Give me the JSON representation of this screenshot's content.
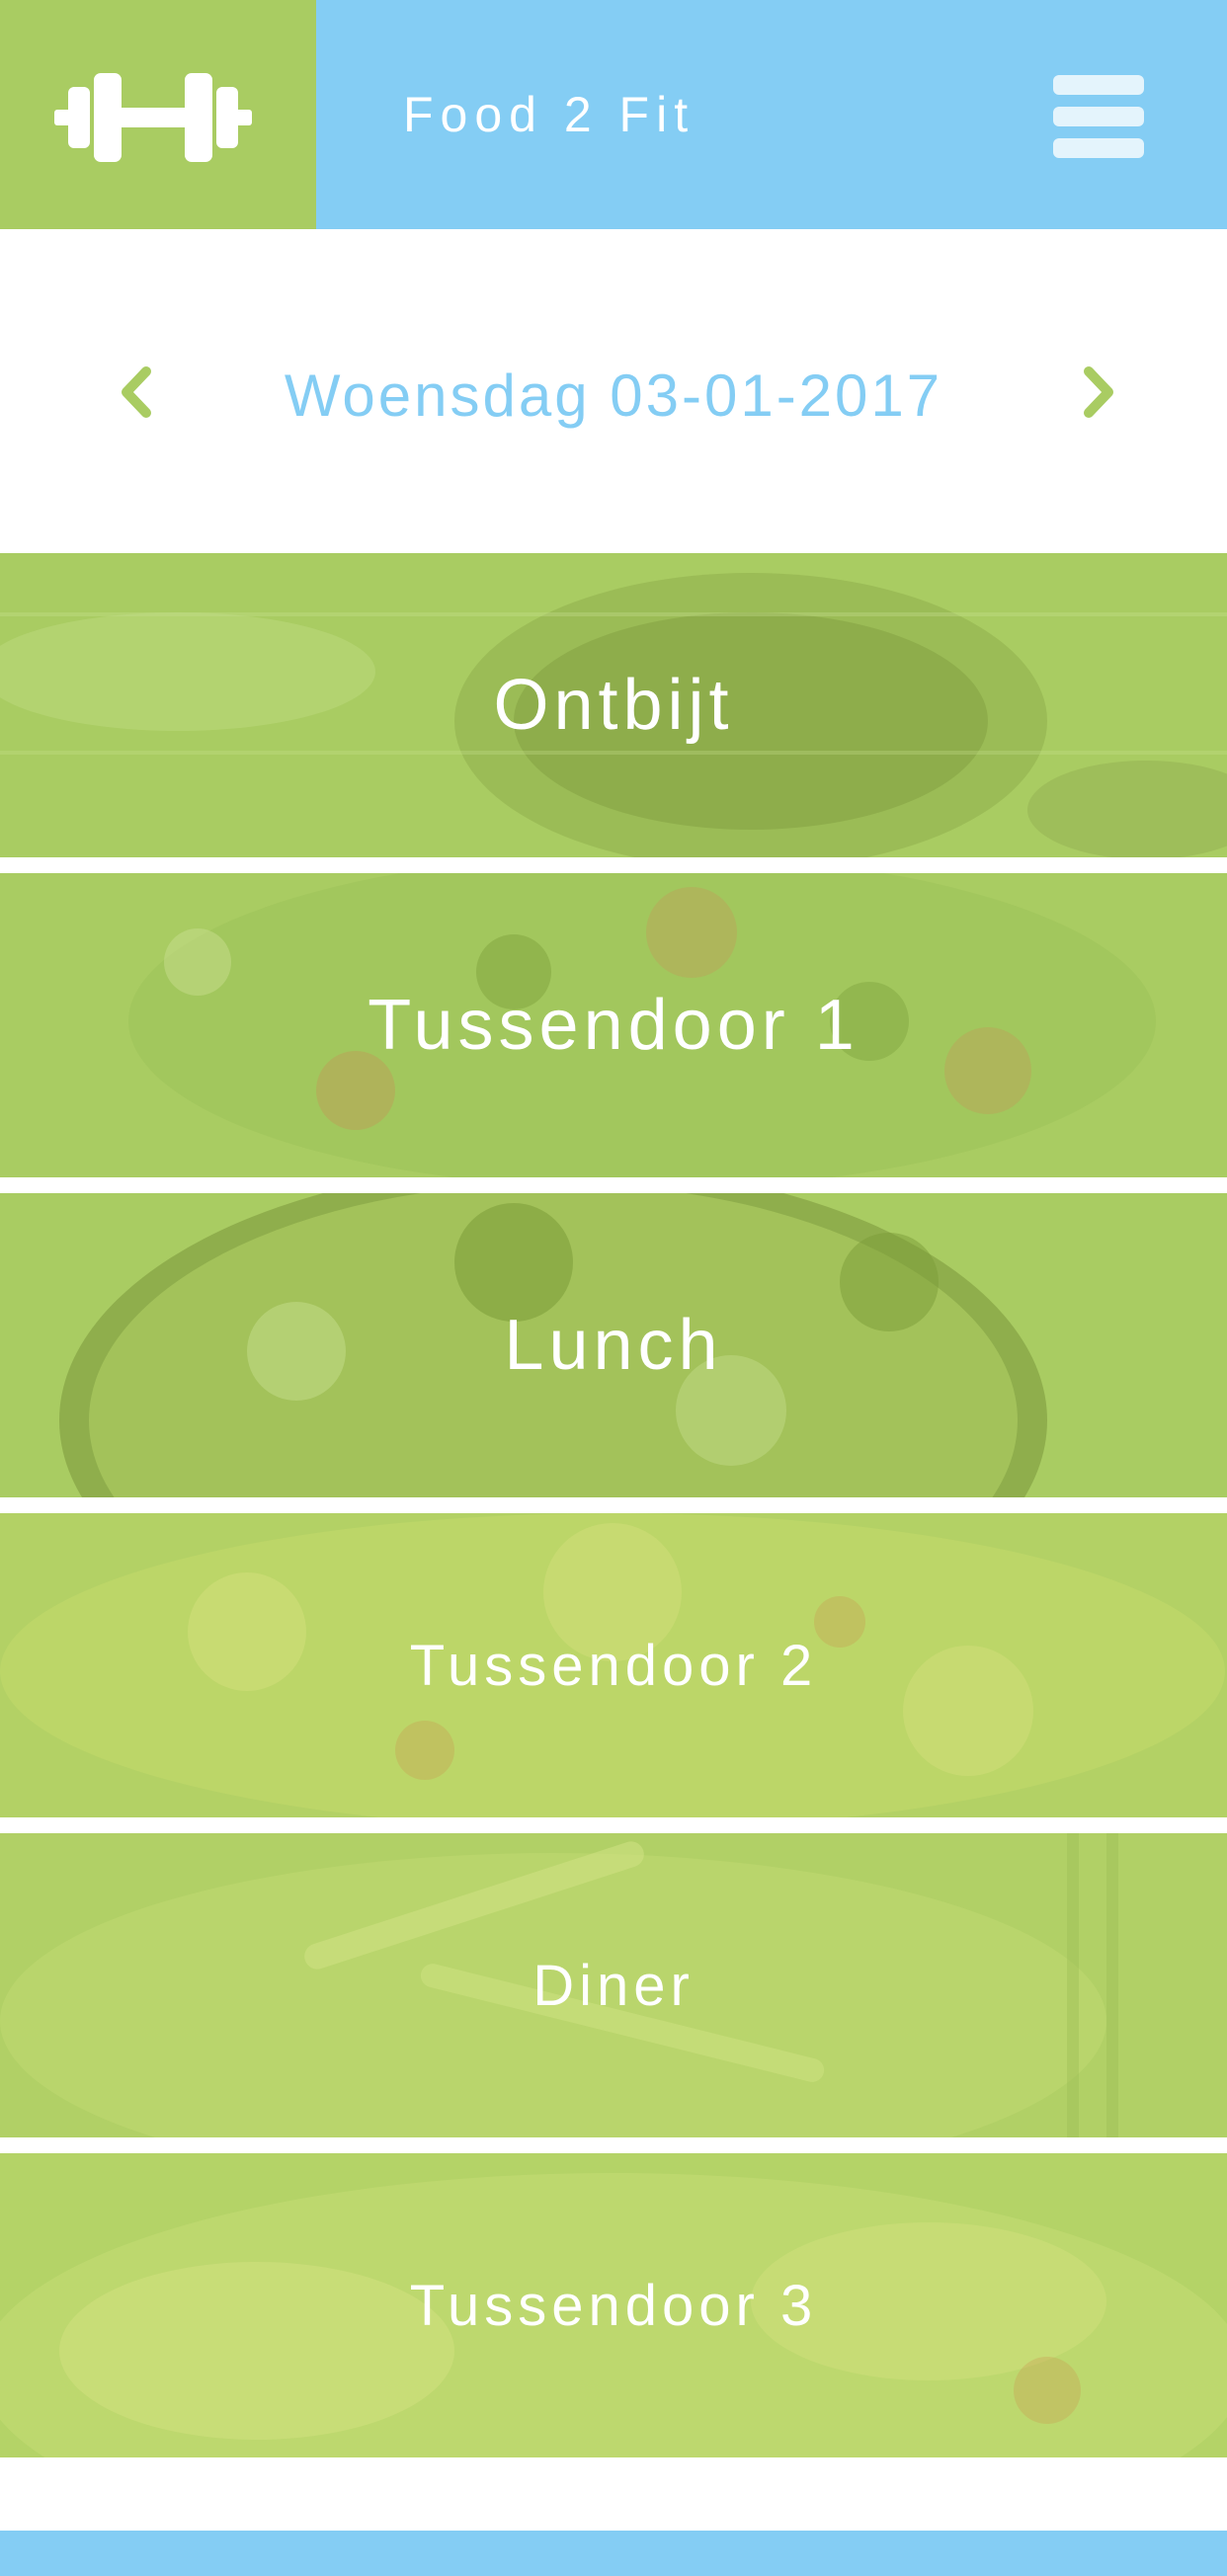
{
  "header": {
    "title": "Food 2 Fit",
    "logo_icon": "dumbbell-icon",
    "menu_icon": "hamburger-menu-icon"
  },
  "date_nav": {
    "date_label": "Woensdag 03-01-2017",
    "prev_icon": "chevron-left-icon",
    "next_icon": "chevron-right-icon"
  },
  "meals": [
    {
      "label": "Ontbijt"
    },
    {
      "label": "Tussendoor 1"
    },
    {
      "label": "Lunch"
    },
    {
      "label": "Tussendoor 2"
    },
    {
      "label": "Diner"
    },
    {
      "label": "Tussendoor 3"
    }
  ],
  "colors": {
    "header_blue": "#84cdf4",
    "brand_green": "#a9cc62",
    "text_white": "#ffffff",
    "date_text": "#84cdf4"
  }
}
